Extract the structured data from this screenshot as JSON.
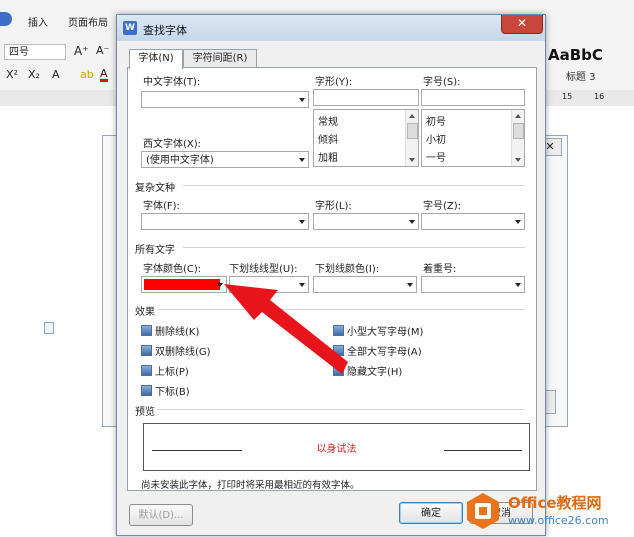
{
  "background": {
    "ribbon_tabs": [
      "插入",
      "页面布局"
    ],
    "font_size_box": "四号",
    "style_preview": "AaBbC",
    "style_name": "标题 3",
    "ruler_marks": [
      "15",
      "16"
    ]
  },
  "dialog": {
    "title": "查找字体",
    "close_label": "✕",
    "tabs": [
      {
        "label": "字体(N)"
      },
      {
        "label": "字符间距(R)"
      }
    ],
    "chinese_font_label": "中文字体(T):",
    "chinese_font_value": "",
    "style_label": "字形(Y):",
    "size_label": "字号(S):",
    "style_options": [
      "常规",
      "倾斜",
      "加粗"
    ],
    "size_options": [
      "初号",
      "小初",
      "一号"
    ],
    "western_font_label": "西文字体(X):",
    "western_font_value": "(使用中文字体)",
    "complex_section": "复杂文种",
    "complex_font_label": "字体(F):",
    "complex_style_label": "字形(L):",
    "complex_size_label": "字号(Z):",
    "all_text_section": "所有文字",
    "font_color_label": "字体颜色(C):",
    "font_color": "#ff0000",
    "underline_type_label": "下划线线型(U):",
    "underline_color_label": "下划线颜色(I):",
    "emphasis_label": "着重号:",
    "effects_section": "效果",
    "effects_left": [
      "删除线(K)",
      "双删除线(G)",
      "上标(P)",
      "下标(B)"
    ],
    "effects_right": [
      "小型大写字母(M)",
      "全部大写字母(A)",
      "隐藏文字(H)"
    ],
    "preview_section": "预览",
    "preview_text": "以身试法",
    "hint": "尚未安装此字体，打印时将采用最相近的有效字体。",
    "default_button": "默认(D)...",
    "ok_button": "确定",
    "cancel_button": "取消"
  },
  "watermark": {
    "title": "Office教程网",
    "url": "www.office26.com"
  },
  "colors": {
    "arrow": "#e8141b",
    "accent": "#3c6fc8"
  }
}
